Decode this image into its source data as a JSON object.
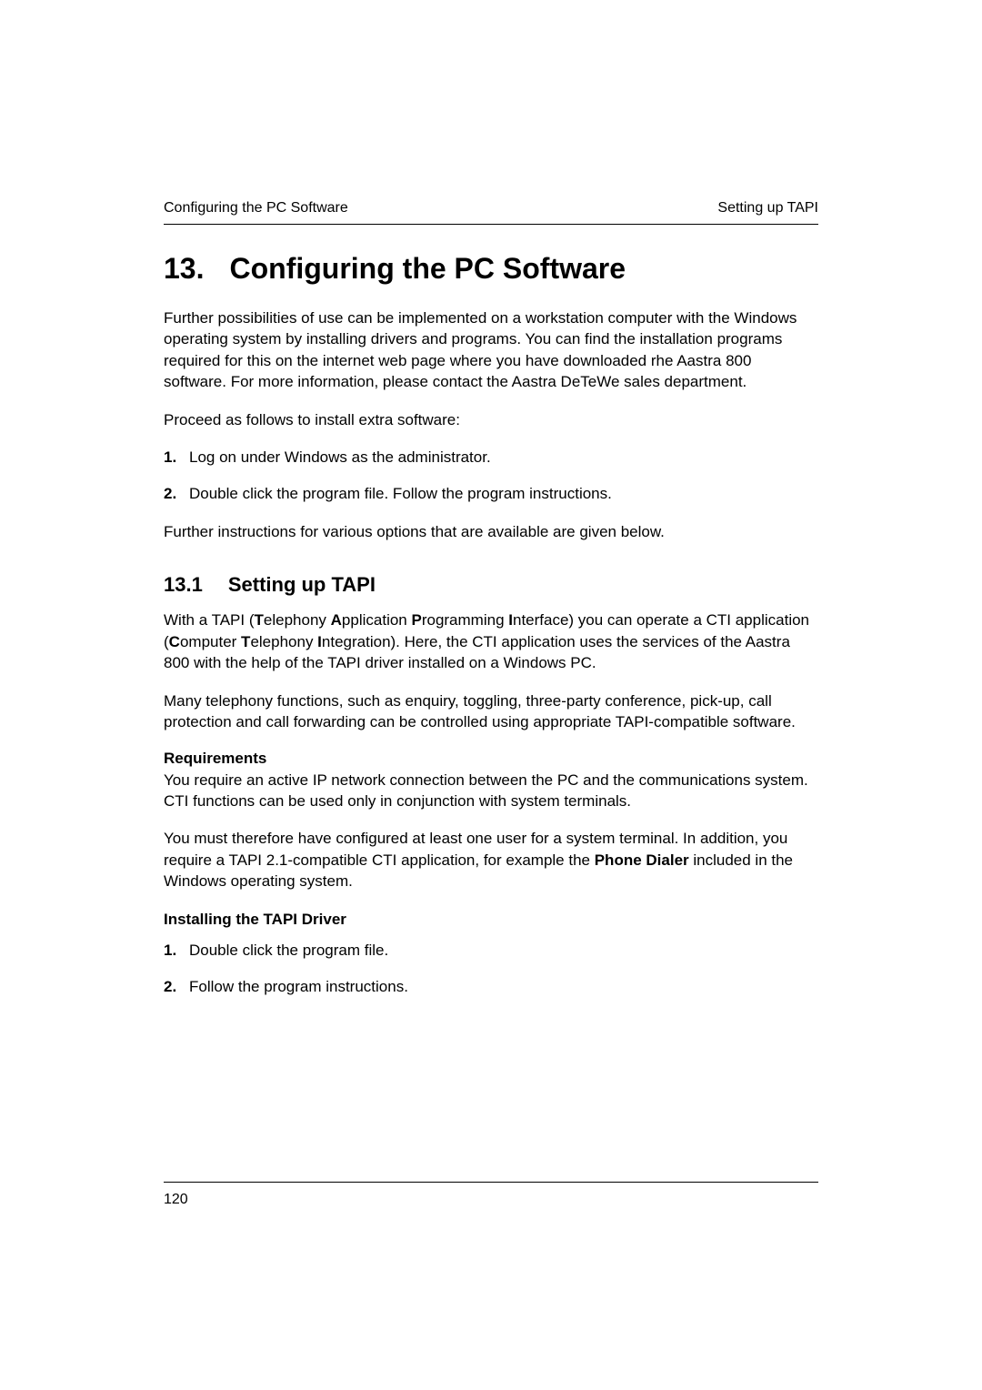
{
  "header": {
    "left": "Configuring the PC Software",
    "right": "Setting up TAPI"
  },
  "chapter": {
    "number": "13.",
    "title": "Configuring the PC Software"
  },
  "intro": {
    "p1": "Further possibilities of use can be implemented on a workstation computer with the Windows operating system by installing drivers and programs. You can find the installation programs required for this on the internet web page where you have downloaded rhe Aastra 800 software. For more information, please contact the Aastra DeTeWe sales department.",
    "p2": "Proceed as follows to install extra software:",
    "steps": [
      "Log on under Windows as the administrator.",
      "Double click the program file. Follow the program instructions."
    ],
    "p3": "Further instructions for various options that are available are given below."
  },
  "section": {
    "number": "13.1",
    "title": "Setting up TAPI",
    "p1_parts": {
      "a": "With a TAPI (",
      "b": "T",
      "c": "elephony ",
      "d": "A",
      "e": "pplication ",
      "f": "P",
      "g": "rogramming ",
      "h": "I",
      "i": "nterface) you can operate a CTI application (",
      "j": "C",
      "k": "omputer ",
      "l": "T",
      "m": "elephony ",
      "n": "I",
      "o": "ntegration). Here, the CTI application uses the services of the Aastra 800 with the help of the TAPI driver installed on a Windows PC."
    },
    "p2": "Many telephony functions, such as enquiry, toggling, three-party conference, pick-up, call protection and call forwarding can be controlled using appropriate TAPI-compatible software.",
    "req_head": "Requirements",
    "req_p1": "You require an active IP network connection between the PC and the communications system. CTI functions can be used only in conjunction with system terminals.",
    "req_p2_parts": {
      "a": "You must therefore have configured at least one user for a system terminal. In addition, you require a TAPI 2.1-compatible CTI application, for example the ",
      "b": "Phone Dialer",
      "c": " included in the Windows operating system."
    },
    "install_head": "Installing the TAPI Driver",
    "install_steps": [
      "Double click the program file.",
      "Follow the program instructions."
    ]
  },
  "footer": {
    "page_number": "120"
  }
}
